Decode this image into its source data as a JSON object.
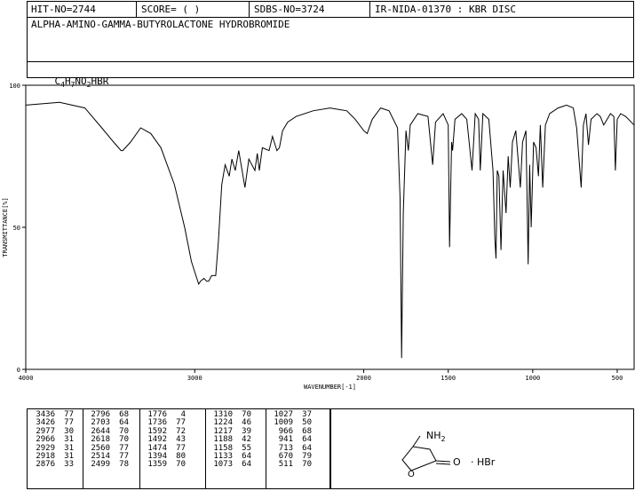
{
  "header": {
    "hit_no": "HIT-NO=2744",
    "score": "SCORE=  (   )",
    "sdbs_no": "SDBS-NO=3724",
    "ir_id": "IR-NIDA-01370 : KBR DISC"
  },
  "compound_name": "ALPHA-AMINO-GAMMA-BUTYROLACTONE HYDROBROMIDE",
  "formula": {
    "c": "C",
    "c_n": "4",
    "h": "H",
    "h_n": "7",
    "n": "NO",
    "o_n": "2",
    "rest": "HBR"
  },
  "structure": {
    "amine": "NH",
    "amine_n": "2",
    "carbonyl": "O",
    "ring_o": "O",
    "salt": "· HBr"
  },
  "chart_data": {
    "type": "line",
    "xlabel": "WAVENUMBER[-1]",
    "ylabel": "TRANSMITTANCE[%]",
    "xlim": [
      4000,
      400
    ],
    "ylim": [
      0,
      100
    ],
    "x_ticks": [
      4000,
      3000,
      2000,
      1500,
      1000,
      500
    ],
    "y_ticks": [
      0,
      50,
      100
    ],
    "series": [
      {
        "points": [
          [
            4000,
            93
          ],
          [
            3800,
            94
          ],
          [
            3650,
            92
          ],
          [
            3550,
            85
          ],
          [
            3480,
            80
          ],
          [
            3436,
            77
          ],
          [
            3426,
            77
          ],
          [
            3380,
            80
          ],
          [
            3320,
            85
          ],
          [
            3260,
            83
          ],
          [
            3200,
            78
          ],
          [
            3120,
            65
          ],
          [
            3060,
            50
          ],
          [
            3020,
            38
          ],
          [
            2977,
            30
          ],
          [
            2966,
            31
          ],
          [
            2946,
            32
          ],
          [
            2929,
            31
          ],
          [
            2918,
            31
          ],
          [
            2900,
            33
          ],
          [
            2876,
            33
          ],
          [
            2860,
            45
          ],
          [
            2840,
            65
          ],
          [
            2820,
            72
          ],
          [
            2796,
            68
          ],
          [
            2780,
            74
          ],
          [
            2760,
            70
          ],
          [
            2740,
            77
          ],
          [
            2703,
            64
          ],
          [
            2680,
            74
          ],
          [
            2644,
            70
          ],
          [
            2630,
            76
          ],
          [
            2618,
            70
          ],
          [
            2600,
            78
          ],
          [
            2560,
            77
          ],
          [
            2540,
            82
          ],
          [
            2514,
            77
          ],
          [
            2499,
            78
          ],
          [
            2480,
            84
          ],
          [
            2450,
            87
          ],
          [
            2400,
            89
          ],
          [
            2300,
            91
          ],
          [
            2200,
            92
          ],
          [
            2100,
            91
          ],
          [
            2050,
            88
          ],
          [
            2000,
            84
          ],
          [
            1980,
            83
          ],
          [
            1950,
            88
          ],
          [
            1900,
            92
          ],
          [
            1850,
            91
          ],
          [
            1800,
            85
          ],
          [
            1785,
            60
          ],
          [
            1776,
            4
          ],
          [
            1766,
            55
          ],
          [
            1750,
            84
          ],
          [
            1736,
            77
          ],
          [
            1725,
            86
          ],
          [
            1680,
            90
          ],
          [
            1620,
            89
          ],
          [
            1592,
            72
          ],
          [
            1575,
            87
          ],
          [
            1530,
            90
          ],
          [
            1500,
            86
          ],
          [
            1492,
            43
          ],
          [
            1480,
            80
          ],
          [
            1474,
            77
          ],
          [
            1460,
            88
          ],
          [
            1420,
            90
          ],
          [
            1390,
            88
          ],
          [
            1359,
            70
          ],
          [
            1340,
            90
          ],
          [
            1320,
            88
          ],
          [
            1310,
            70
          ],
          [
            1295,
            90
          ],
          [
            1260,
            88
          ],
          [
            1235,
            70
          ],
          [
            1224,
            46
          ],
          [
            1217,
            39
          ],
          [
            1210,
            70
          ],
          [
            1200,
            68
          ],
          [
            1188,
            42
          ],
          [
            1175,
            70
          ],
          [
            1158,
            55
          ],
          [
            1145,
            75
          ],
          [
            1133,
            64
          ],
          [
            1120,
            80
          ],
          [
            1100,
            84
          ],
          [
            1073,
            64
          ],
          [
            1060,
            80
          ],
          [
            1040,
            84
          ],
          [
            1027,
            37
          ],
          [
            1018,
            72
          ],
          [
            1009,
            50
          ],
          [
            995,
            80
          ],
          [
            980,
            78
          ],
          [
            966,
            68
          ],
          [
            955,
            86
          ],
          [
            941,
            64
          ],
          [
            925,
            86
          ],
          [
            900,
            90
          ],
          [
            850,
            92
          ],
          [
            800,
            93
          ],
          [
            760,
            92
          ],
          [
            740,
            85
          ],
          [
            713,
            64
          ],
          [
            700,
            86
          ],
          [
            685,
            90
          ],
          [
            670,
            79
          ],
          [
            655,
            88
          ],
          [
            620,
            90
          ],
          [
            600,
            89
          ],
          [
            580,
            86
          ],
          [
            560,
            88
          ],
          [
            540,
            90
          ],
          [
            520,
            89
          ],
          [
            511,
            70
          ],
          [
            500,
            88
          ],
          [
            480,
            90
          ],
          [
            450,
            89
          ],
          [
            400,
            86
          ]
        ]
      }
    ]
  },
  "peak_table": [
    [
      [
        "3436",
        "77"
      ],
      [
        "3426",
        "77"
      ],
      [
        "2977",
        "30"
      ],
      [
        "2966",
        "31"
      ],
      [
        "2929",
        "31"
      ],
      [
        "2918",
        "31"
      ],
      [
        "2876",
        "33"
      ]
    ],
    [
      [
        "2796",
        "68"
      ],
      [
        "2703",
        "64"
      ],
      [
        "2644",
        "70"
      ],
      [
        "2618",
        "70"
      ],
      [
        "2560",
        "77"
      ],
      [
        "2514",
        "77"
      ],
      [
        "2499",
        "78"
      ]
    ],
    [
      [
        "1776",
        "4"
      ],
      [
        "1736",
        "77"
      ],
      [
        "1592",
        "72"
      ],
      [
        "1492",
        "43"
      ],
      [
        "1474",
        "77"
      ],
      [
        "1394",
        "80"
      ],
      [
        "1359",
        "70"
      ]
    ],
    [
      [
        "1310",
        "70"
      ],
      [
        "1224",
        "46"
      ],
      [
        "1217",
        "39"
      ],
      [
        "1188",
        "42"
      ],
      [
        "1158",
        "55"
      ],
      [
        "1133",
        "64"
      ],
      [
        "1073",
        "64"
      ]
    ],
    [
      [
        "1027",
        "37"
      ],
      [
        "1009",
        "50"
      ],
      [
        "966",
        "68"
      ],
      [
        "941",
        "64"
      ],
      [
        "713",
        "64"
      ],
      [
        "670",
        "79"
      ],
      [
        "511",
        "70"
      ]
    ]
  ]
}
